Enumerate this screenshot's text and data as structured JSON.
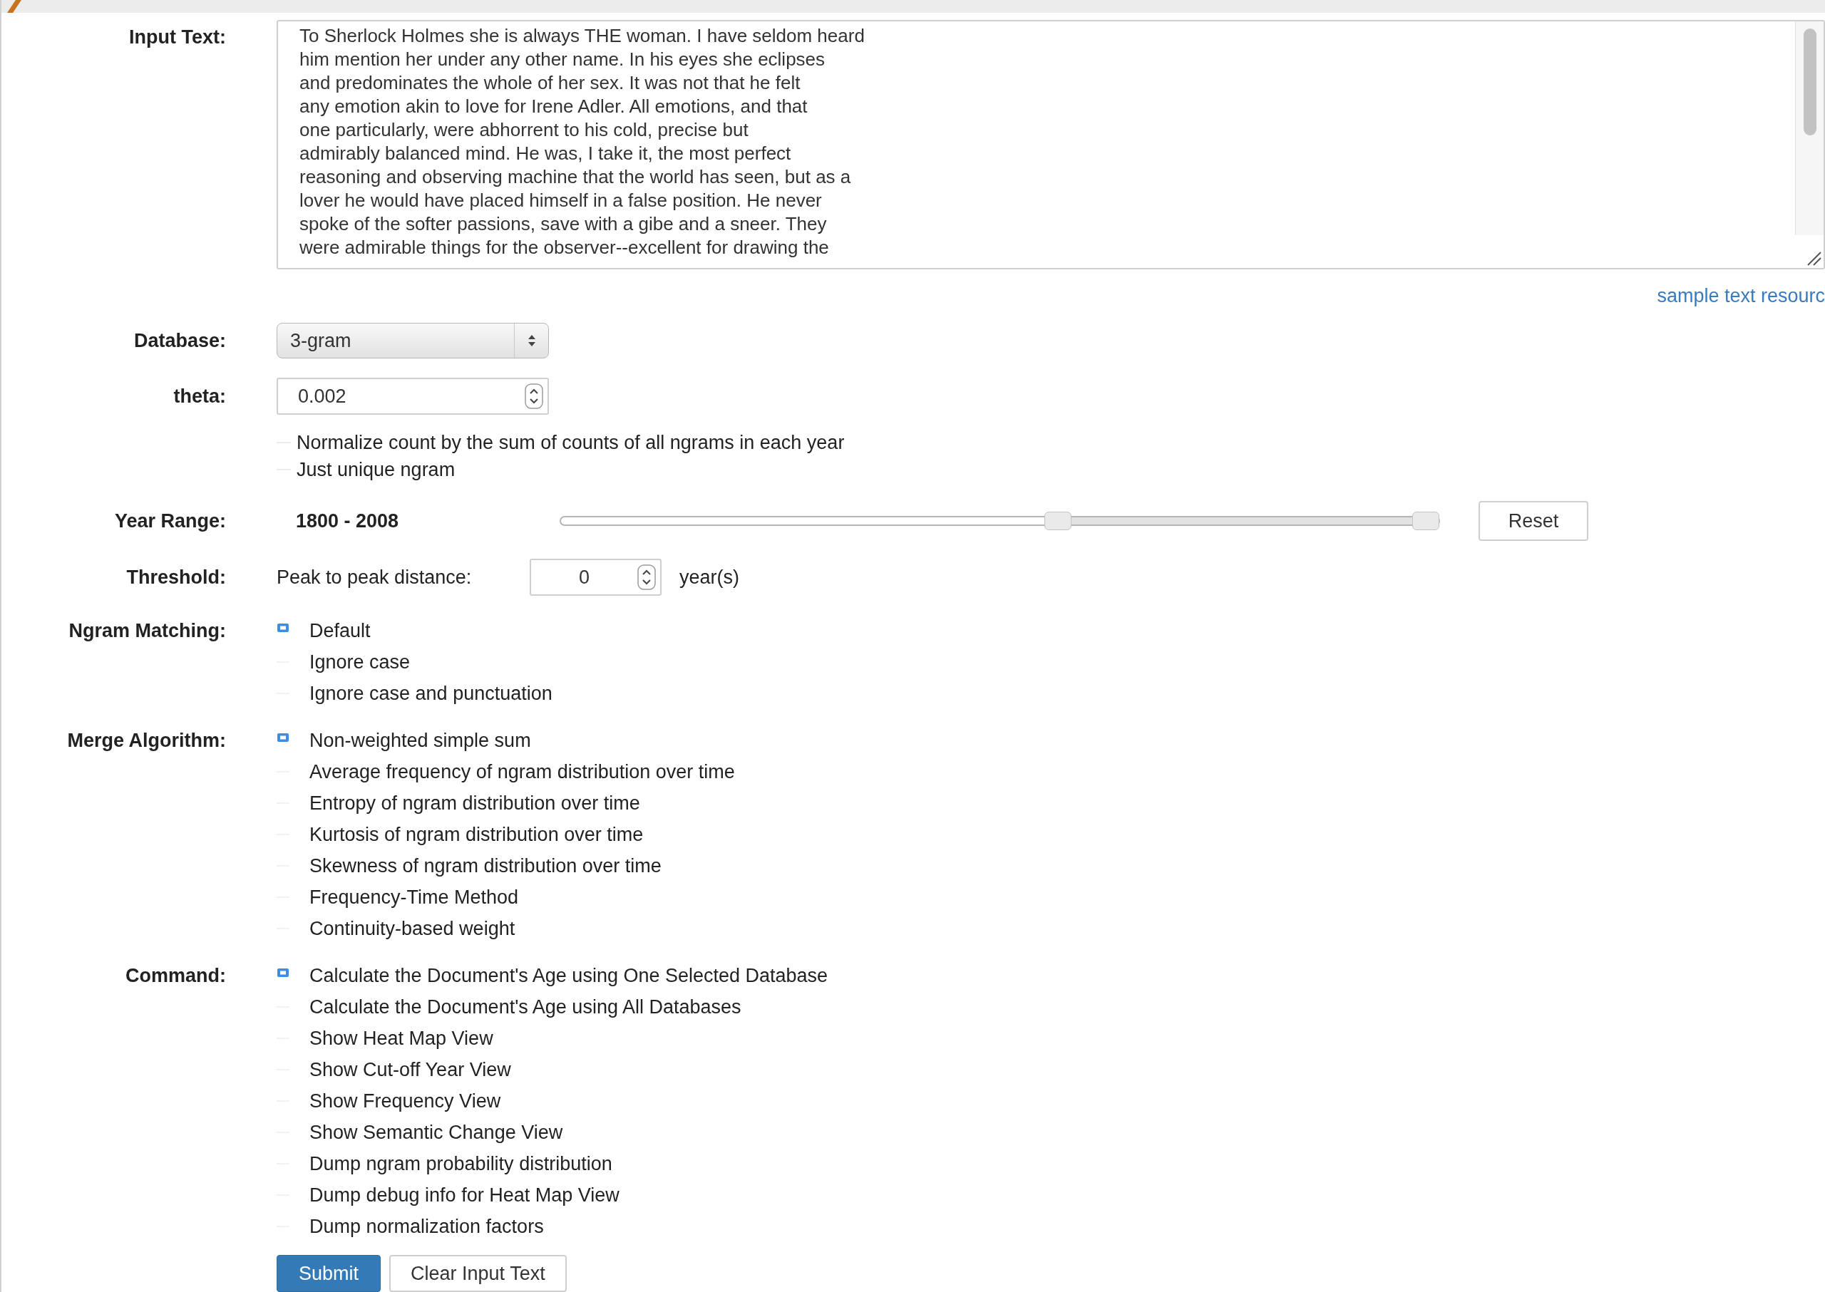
{
  "input_text": {
    "label": "Input Text:",
    "lines": [
      "To Sherlock Holmes she is always THE woman. I have seldom heard",
      "him mention her under any other name. In his eyes she eclipses",
      "and predominates the whole of her sex. It was not that he felt",
      "any emotion akin to love for Irene Adler. All emotions, and that",
      "one particularly, were abhorrent to his cold, precise but",
      "admirably balanced mind. He was, I take it, the most perfect",
      "reasoning and observing machine that the world has seen, but as a",
      "lover he would have placed himself in a false position. He never",
      "spoke of the softer passions, save with a gibe and a sneer. They",
      "were admirable things for the observer--excellent for drawing the"
    ]
  },
  "sample_link": "sample text resourc",
  "database": {
    "label": "Database:",
    "value": "3-gram"
  },
  "theta": {
    "label": "theta:",
    "value": "0.002"
  },
  "options": [
    {
      "label": "Normalize count by the sum of counts of all ngrams in each year",
      "checked": false
    },
    {
      "label": "Just unique ngram",
      "checked": false
    }
  ],
  "year_range": {
    "label": "Year Range:",
    "reading": "1800 - 2008",
    "handles": [
      {
        "level": 0.566
      },
      {
        "level": 0.985
      }
    ],
    "reset": "Reset"
  },
  "threshold": {
    "label": "Threshold:",
    "caption": "Peak to peak distance:",
    "value": "0",
    "unit": "year(s)"
  },
  "groups": [
    {
      "label": "Ngram Matching:",
      "items": [
        {
          "label": "Default",
          "selected": true
        },
        {
          "label": "Ignore case",
          "selected": false
        },
        {
          "label": "Ignore case and punctuation",
          "selected": false
        }
      ]
    },
    {
      "label": "Merge Algorithm:",
      "items": [
        {
          "label": "Non-weighted simple sum",
          "selected": true
        },
        {
          "label": "Average frequency of ngram distribution over time",
          "selected": false
        },
        {
          "label": "Entropy of ngram distribution over time",
          "selected": false
        },
        {
          "label": "Kurtosis of ngram distribution over time",
          "selected": false
        },
        {
          "label": "Skewness of ngram distribution over time",
          "selected": false
        },
        {
          "label": "Frequency-Time Method",
          "selected": false
        },
        {
          "label": "Continuity-based weight",
          "selected": false
        }
      ]
    },
    {
      "label": "Command:",
      "items": [
        {
          "label": "Calculate the Document's Age using One Selected Database",
          "selected": true
        },
        {
          "label": "Calculate the Document's Age using All Databases",
          "selected": false
        },
        {
          "label": "Show Heat Map View",
          "selected": false
        },
        {
          "label": "Show Cut-off Year View",
          "selected": false
        },
        {
          "label": "Show Frequency View",
          "selected": false
        },
        {
          "label": "Show Semantic Change View",
          "selected": false
        },
        {
          "label": "Dump ngram probability distribution",
          "selected": false
        },
        {
          "label": "Dump debug info for Heat Map View",
          "selected": false
        },
        {
          "label": "Dump normalization factors",
          "selected": false
        }
      ]
    }
  ],
  "buttons": [
    {
      "label": "Submit",
      "kind": "primary"
    },
    {
      "label": "Clear Input Text",
      "kind": "default"
    }
  ]
}
